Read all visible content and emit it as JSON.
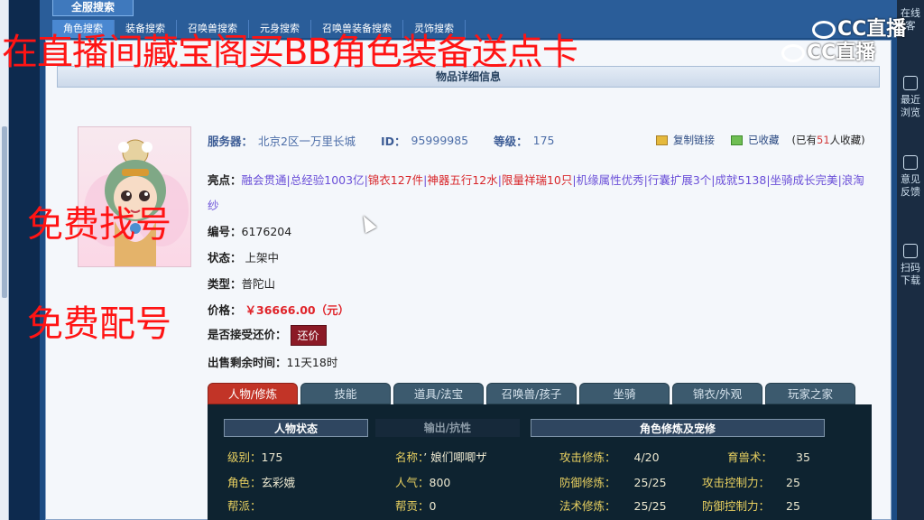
{
  "top": {
    "global_search": "全服搜索",
    "search_tabs": [
      "角色搜索",
      "装备搜索",
      "召唤兽搜索",
      "元身搜索",
      "召唤兽装备搜索",
      "灵饰搜索"
    ]
  },
  "overlay": {
    "top_banner": "在直播间藏宝阁买BB角色装备送点卡",
    "free_find": "免费找号",
    "free_match": "免费配号"
  },
  "panel": {
    "header": "物品详细信息",
    "server_label": "服务器：",
    "server_value": "北京2区一万里长城",
    "id_label": "ID：",
    "id_value": "95999985",
    "level_label": "等级：",
    "level_value": "175",
    "copy_link": "复制链接",
    "favorited": "已收藏",
    "fav_count_prefix": "(已有",
    "fav_count": "51",
    "fav_count_suffix": "人收藏)",
    "highlights_label": "亮点：",
    "highlights": [
      {
        "text": "融会贯通",
        "color": "purple"
      },
      {
        "text": "总经验1003亿",
        "color": "purple"
      },
      {
        "text": "锦衣127件",
        "color": "red"
      },
      {
        "text": "神器五行12水",
        "color": "red"
      },
      {
        "text": "限量祥瑞10只",
        "color": "red"
      },
      {
        "text": "机缘属性优秀",
        "color": "purple"
      },
      {
        "text": "行囊扩展3个",
        "color": "purple"
      },
      {
        "text": "成就5138",
        "color": "purple"
      },
      {
        "text": "坐骑成长完美",
        "color": "purple"
      },
      {
        "text": "浪淘纱",
        "color": "purple"
      }
    ],
    "serial_label": "编号：",
    "serial_value": "6176204",
    "status_label": "状态：",
    "status_value": "上架中",
    "type_label": "类型：",
    "type_value": "普陀山",
    "price_label": "价格：",
    "price_value": "￥36666.00（元）",
    "bargain_label": "是否接受还价：",
    "bargain_button": "还价",
    "time_left_label": "出售剩余时间：",
    "time_left_value": "11天18时"
  },
  "item_tabs": [
    "人物/修炼",
    "技能",
    "道具/法宝",
    "召唤兽/孩子",
    "坐骑",
    "锦衣/外观",
    "玩家之家"
  ],
  "stats": {
    "sec_char": "人物状态",
    "sec_output": "输出/抗性",
    "sec_cultivation": "角色修炼及宠修",
    "level_k": "级别：",
    "level_v": "175",
    "name_k": "名称：",
    "name_v": "’ 娘们唧唧ザ",
    "atk_k": "攻击修炼：",
    "atk_v": "4/20",
    "beast_k": "育兽术：",
    "beast_v": "35",
    "role_k": "角色：",
    "role_v": "玄彩娥",
    "pop_k": "人气：",
    "pop_v": "800",
    "def_k": "防御修炼：",
    "def_v": "25/25",
    "atkctl_k": "攻击控制力：",
    "atkctl_v": "25",
    "gang_k": "帮派：",
    "gang_v": "",
    "contrib_k": "帮贡：",
    "contrib_v": "0",
    "magic_k": "法术修炼：",
    "magic_v": "25/25",
    "defctl_k": "防御控制力：",
    "defctl_v": "25"
  },
  "sidebar": {
    "top_text": "在线\n客",
    "item1": "最近浏览",
    "item2": "意见反馈",
    "item3": "扫码下载"
  },
  "logo": {
    "text": "CC直播"
  }
}
